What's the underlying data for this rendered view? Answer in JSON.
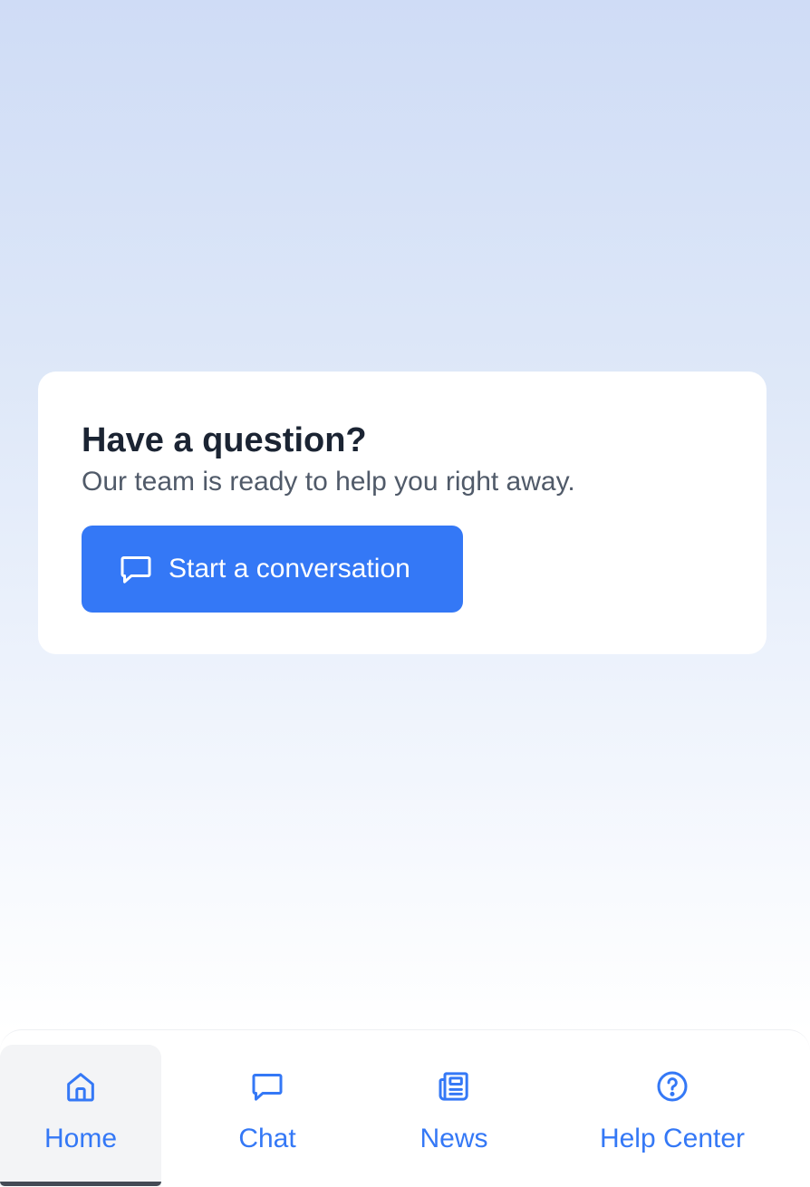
{
  "card": {
    "title": "Have a question?",
    "subtitle": "Our team is ready to help you right away.",
    "button_label": "Start a conversation",
    "button_icon": "chat-bubble-icon"
  },
  "nav": {
    "items": [
      {
        "label": "Home",
        "icon": "home-icon",
        "active": true
      },
      {
        "label": "Chat",
        "icon": "chat-bubble-icon",
        "active": false
      },
      {
        "label": "News",
        "icon": "newspaper-icon",
        "active": false
      },
      {
        "label": "Help Center",
        "icon": "question-circle-icon",
        "active": false
      }
    ]
  },
  "colors": {
    "accent": "#3478f6",
    "title_text": "#1b2433",
    "body_text": "#505a69",
    "background_top": "#cfdcf6",
    "active_indicator": "#444a55"
  }
}
